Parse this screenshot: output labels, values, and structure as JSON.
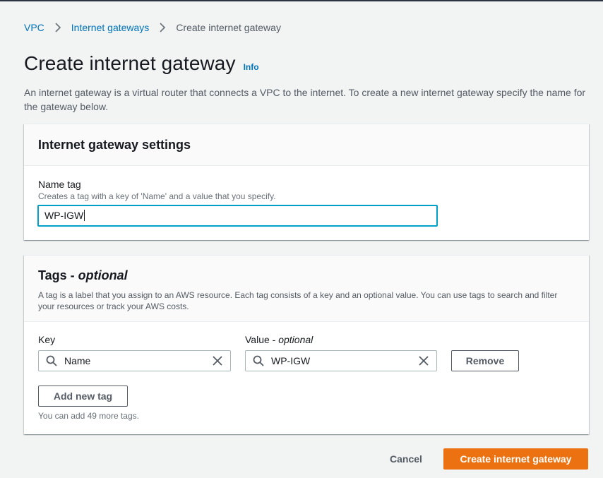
{
  "breadcrumb": {
    "items": [
      {
        "label": "VPC"
      },
      {
        "label": "Internet gateways"
      },
      {
        "label": "Create internet gateway"
      }
    ]
  },
  "header": {
    "title": "Create internet gateway",
    "info_label": "Info",
    "description": "An internet gateway is a virtual router that connects a VPC to the internet. To create a new internet gateway specify the name for the gateway below."
  },
  "settings": {
    "title": "Internet gateway settings",
    "name_tag_label": "Name tag",
    "name_tag_description": "Creates a tag with a key of 'Name' and a value that you specify.",
    "name_tag_value": "WP-IGW"
  },
  "tags": {
    "title_main": "Tags - ",
    "title_optional": "optional",
    "description": "A tag is a label that you assign to an AWS resource. Each tag consists of a key and an optional value. You can use tags to search and filter your resources or track your AWS costs.",
    "key_label": "Key",
    "value_label_main": "Value - ",
    "value_label_optional": "optional",
    "rows": [
      {
        "key": "Name",
        "value": "WP-IGW",
        "remove_label": "Remove"
      }
    ],
    "add_label": "Add new tag",
    "hint": "You can add 49 more tags."
  },
  "footer": {
    "cancel_label": "Cancel",
    "submit_label": "Create internet gateway"
  },
  "colors": {
    "link": "#0073bb",
    "primary": "#ec7211",
    "focus": "#00a1c9",
    "background": "#f2f3f3"
  },
  "icons": {
    "breadcrumb_separator": "chevron-right-icon",
    "input_prefix": "search-icon",
    "input_clear": "clear-icon"
  }
}
